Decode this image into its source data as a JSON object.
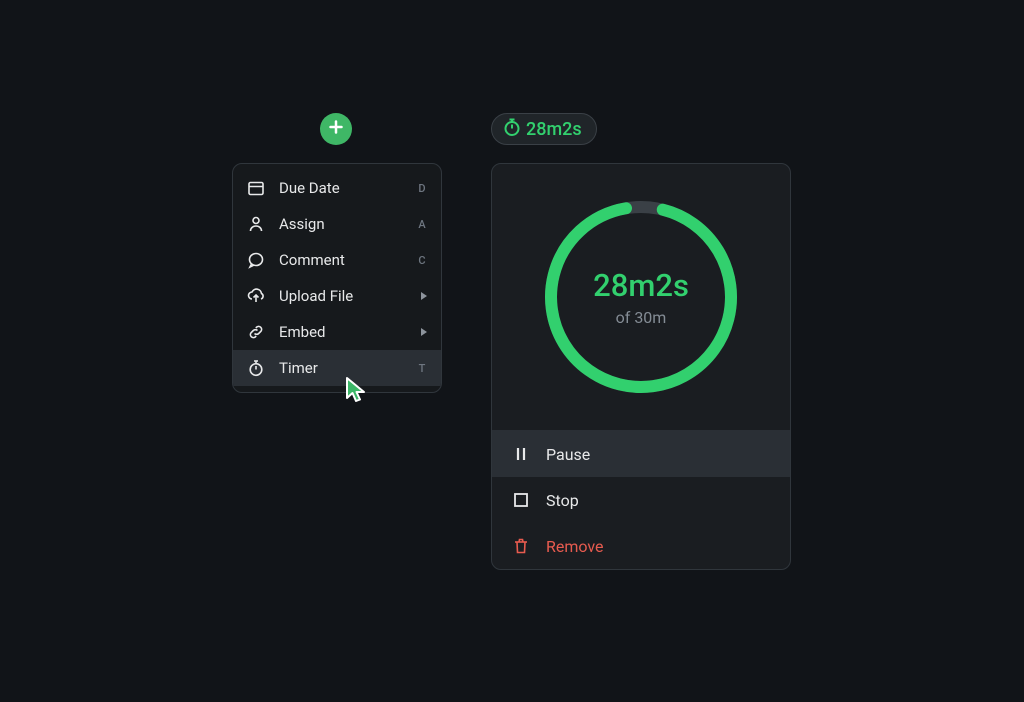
{
  "plus_button": {},
  "timer_badge": {
    "text": "28m2s"
  },
  "menu": {
    "items": [
      {
        "id": "due-date",
        "label": "Due Date",
        "shortcut": "D",
        "has_submenu": false
      },
      {
        "id": "assign",
        "label": "Assign",
        "shortcut": "A",
        "has_submenu": false
      },
      {
        "id": "comment",
        "label": "Comment",
        "shortcut": "C",
        "has_submenu": false
      },
      {
        "id": "upload-file",
        "label": "Upload File",
        "shortcut": "",
        "has_submenu": true
      },
      {
        "id": "embed",
        "label": "Embed",
        "shortcut": "",
        "has_submenu": true
      },
      {
        "id": "timer",
        "label": "Timer",
        "shortcut": "T",
        "has_submenu": false,
        "hover": true
      }
    ]
  },
  "timer": {
    "elapsed_text": "28m2s",
    "of_text": "of 30m",
    "progress": 0.934,
    "actions": [
      {
        "id": "pause",
        "label": "Pause",
        "highlighted": true
      },
      {
        "id": "stop",
        "label": "Stop",
        "highlighted": false
      },
      {
        "id": "remove",
        "label": "Remove",
        "highlighted": false
      }
    ]
  },
  "colors": {
    "accent": "#32d06e",
    "danger": "#e75b4f",
    "text": "#e8e9ea",
    "muted": "#848c95"
  }
}
